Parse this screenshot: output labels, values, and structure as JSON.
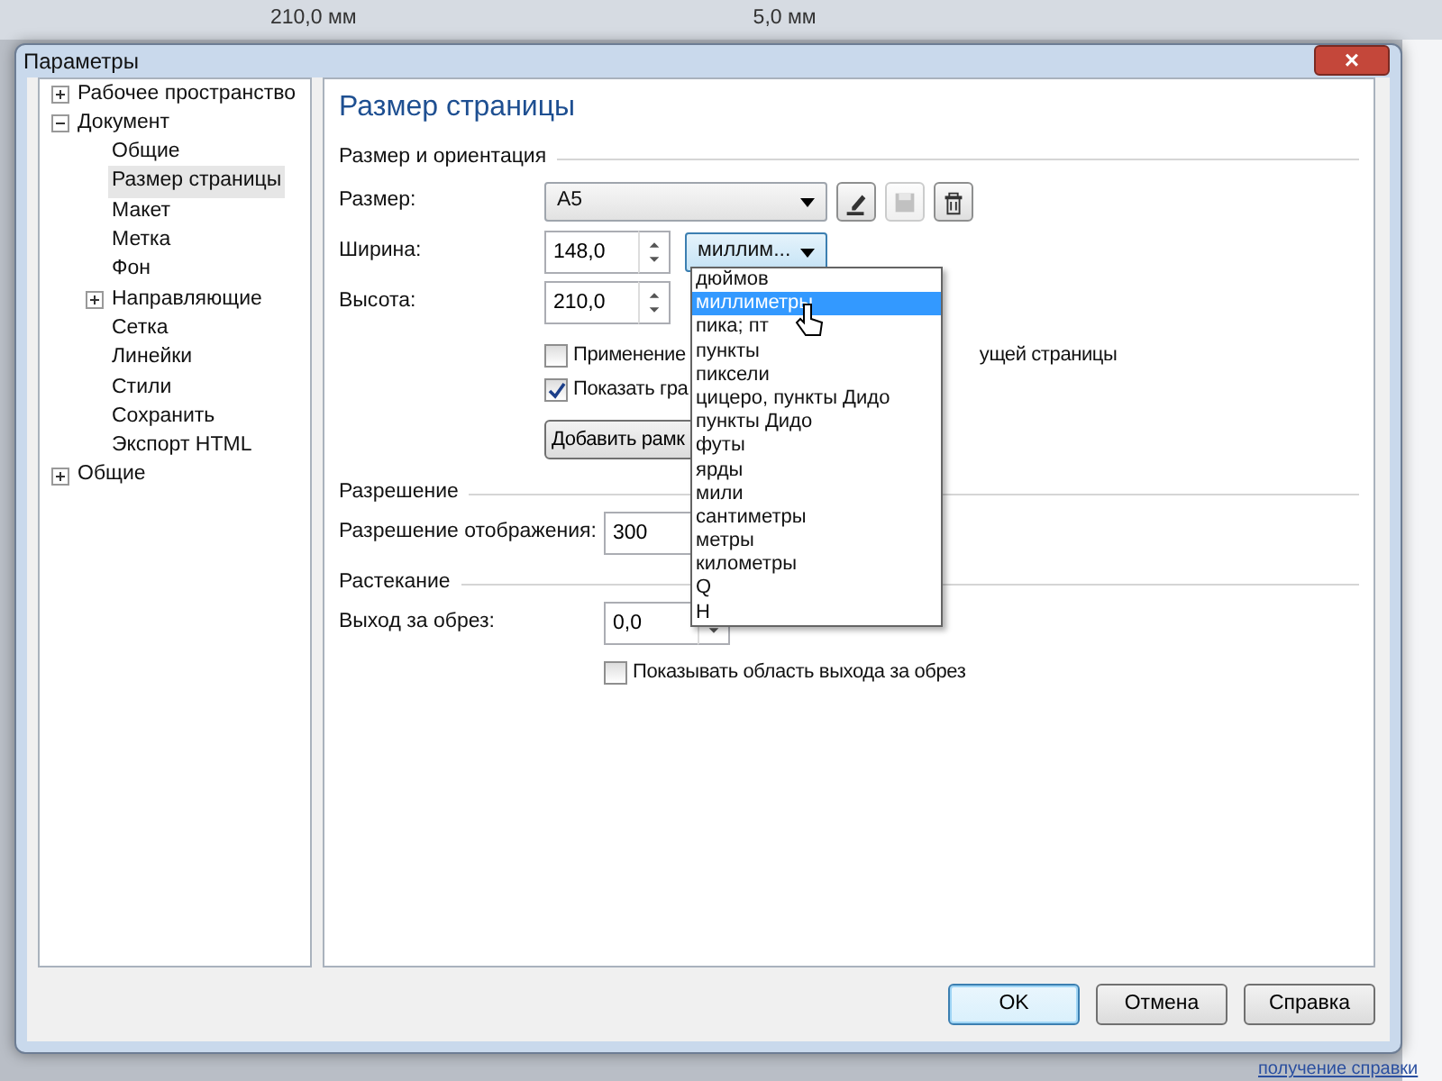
{
  "background_app": {
    "toolbar_texts": [
      "210,0 мм",
      "5,0 мм"
    ],
    "bottom_link": "получение справки"
  },
  "window": {
    "title": "Параметры",
    "close": "×"
  },
  "tree": [
    {
      "label": "Рабочее пространство",
      "expanded": false,
      "selected": false
    },
    {
      "label": "Документ",
      "expanded": true,
      "selected": false,
      "children": [
        {
          "label": "Общие",
          "selected": false
        },
        {
          "label": "Размер страницы",
          "selected": true
        },
        {
          "label": "Макет",
          "selected": false
        },
        {
          "label": "Метка",
          "selected": false
        },
        {
          "label": "Фон",
          "selected": false
        },
        {
          "label": "Направляющие",
          "expanded": false,
          "selected": false
        },
        {
          "label": "Сетка",
          "selected": false
        },
        {
          "label": "Линейки",
          "selected": false
        },
        {
          "label": "Стили",
          "selected": false
        },
        {
          "label": "Сохранить",
          "selected": false
        },
        {
          "label": "Экспорт HTML",
          "selected": false
        }
      ]
    },
    {
      "label": "Общие",
      "expanded": false,
      "selected": false
    }
  ],
  "page_title": "Размер страницы",
  "size_section": {
    "title": "Размер и ориентация",
    "size": {
      "label": "Размер:",
      "value": "A5"
    },
    "icon_buttons": [
      {
        "kind": "edit",
        "disabled": false
      },
      {
        "kind": "save",
        "disabled": true
      },
      {
        "kind": "delete",
        "disabled": false
      }
    ],
    "width": {
      "label": "Ширина:",
      "value": "148,0"
    },
    "height": {
      "label": "Высота:",
      "value": "210,0"
    },
    "units": {
      "value": "миллим...",
      "open": true,
      "options": [
        {
          "label": "дюймов",
          "selected": false
        },
        {
          "label": "миллиметры",
          "selected": true
        },
        {
          "label": "пика; пт",
          "selected": false
        },
        {
          "label": "пункты",
          "selected": false
        },
        {
          "label": "пиксели",
          "selected": false
        },
        {
          "label": "цицеро, пункты Дидо",
          "selected": false
        },
        {
          "label": "пункты Дидо",
          "selected": false
        },
        {
          "label": "футы",
          "selected": false
        },
        {
          "label": "ярды",
          "selected": false
        },
        {
          "label": "мили",
          "selected": false
        },
        {
          "label": "сантиметры",
          "selected": false
        },
        {
          "label": "метры",
          "selected": false
        },
        {
          "label": "километры",
          "selected": false
        },
        {
          "label": "Q",
          "selected": false
        },
        {
          "label": "H",
          "selected": false
        }
      ]
    },
    "checkboxes": [
      {
        "label": "Применение",
        "tail": "ущей страницы",
        "checked": false
      },
      {
        "label": "Показать гра",
        "checked": true
      }
    ],
    "add_button": "Добавить рамк"
  },
  "resolution_section": {
    "title": "Разрешение",
    "label": "Разрешение отображения:",
    "value": "300"
  },
  "bleed_section": {
    "title": "Растекание",
    "label": "Выход за обрез:",
    "value": "0,0",
    "checkbox": {
      "label": "Показывать область выхода за обрез",
      "checked": false
    }
  },
  "buttons": [
    {
      "label": "OK",
      "default": true
    },
    {
      "label": "Отмена",
      "default": false
    },
    {
      "label": "Справка",
      "default": false
    }
  ]
}
